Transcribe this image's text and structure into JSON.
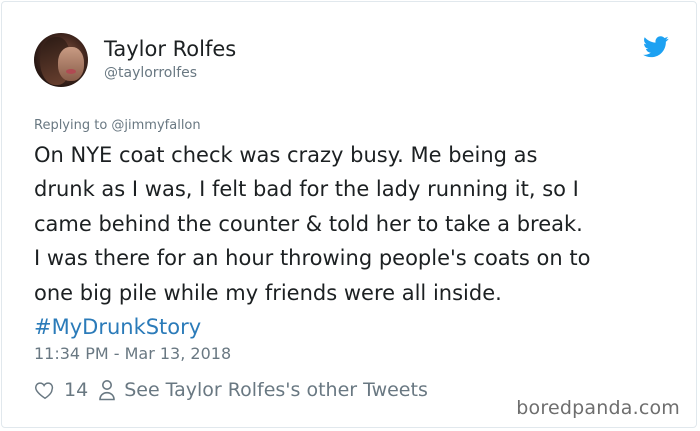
{
  "author": {
    "name": "Taylor Rolfes",
    "handle": "@taylorrolfes"
  },
  "reply_context": "Replying to @jimmyfallon",
  "tweet": {
    "lines": [
      "On NYE coat check was crazy busy. Me being as",
      "drunk as I was, I felt bad for the lady running it, so I",
      "came behind the counter & told her to take a break.",
      "I was there for an hour throwing people's coats on to",
      "one big pile while my friends were all inside."
    ],
    "hashtag": "#MyDrunkStory"
  },
  "timestamp": "11:34 PM - Mar 13, 2018",
  "actions": {
    "like_count": "14",
    "other_tweets_label": "See Taylor Rolfes's other Tweets"
  },
  "watermark": "boredpanda.com",
  "icons": {
    "brand": "twitter-bird-icon",
    "like": "heart-icon",
    "profile": "person-icon"
  },
  "colors": {
    "twitter_blue": "#1da1f2",
    "hashtag": "#2b7bb9",
    "text": "#1c2022",
    "muted": "#697882"
  }
}
